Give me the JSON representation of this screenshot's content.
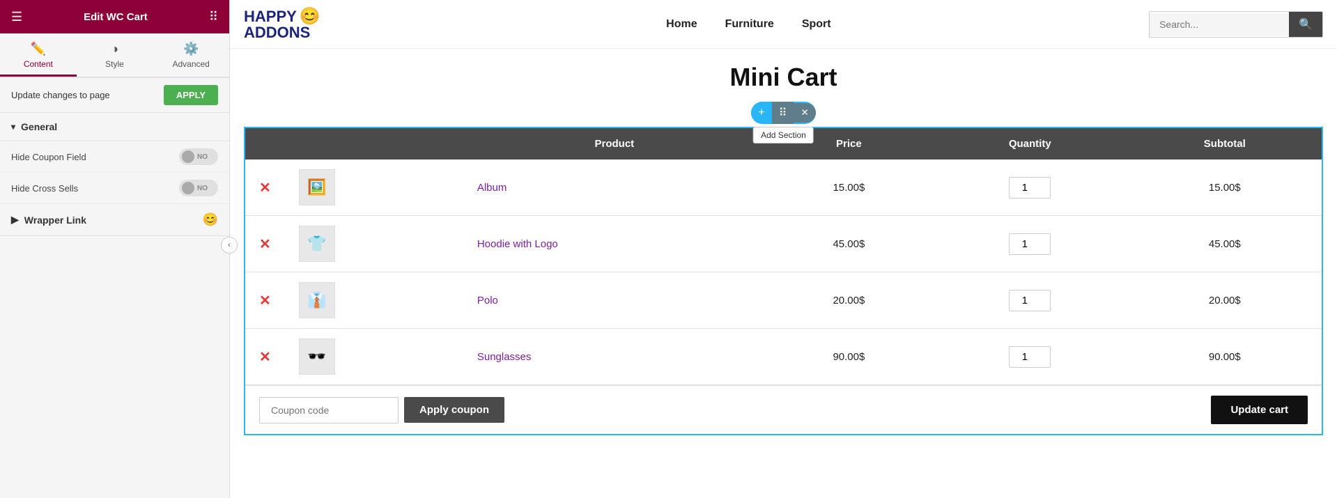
{
  "header": {
    "title": "Edit WC Cart"
  },
  "tabs": [
    {
      "id": "content",
      "label": "Content",
      "icon": "✏️",
      "active": true
    },
    {
      "id": "style",
      "label": "Style",
      "icon": "◑",
      "active": false
    },
    {
      "id": "advanced",
      "label": "Advanced",
      "icon": "⚙️",
      "active": false
    }
  ],
  "panel": {
    "update_label": "Update changes to page",
    "apply_btn": "APPLY",
    "general_section": "General",
    "hide_coupon_field_label": "Hide Coupon Field",
    "hide_cross_sells_label": "Hide Cross Sells",
    "wrapper_link_label": "Wrapper Link",
    "toggle_no": "NO"
  },
  "nav": {
    "logo_line1": "HAPPY",
    "logo_line2": "ADDONS",
    "logo_emoji": "😊",
    "links": [
      "Home",
      "Furniture",
      "Sport"
    ],
    "search_placeholder": "Search..."
  },
  "page": {
    "title": "Mini Cart",
    "add_section_tooltip": "Add Section"
  },
  "cart": {
    "headers": [
      "",
      "",
      "Product",
      "Price",
      "Quantity",
      "Subtotal"
    ],
    "items": [
      {
        "id": 1,
        "name": "Album",
        "thumb": "🖼️",
        "price": "15.00$",
        "qty": 1,
        "subtotal": "15.00$"
      },
      {
        "id": 2,
        "name": "Hoodie with Logo",
        "thumb": "👕",
        "price": "45.00$",
        "qty": 1,
        "subtotal": "45.00$"
      },
      {
        "id": 3,
        "name": "Polo",
        "thumb": "👔",
        "price": "20.00$",
        "qty": 1,
        "subtotal": "20.00$"
      },
      {
        "id": 4,
        "name": "Sunglasses",
        "thumb": "🕶️",
        "price": "90.00$",
        "qty": 1,
        "subtotal": "90.00$"
      }
    ],
    "coupon_placeholder": "Coupon code",
    "apply_coupon_btn": "Apply coupon",
    "update_cart_btn": "Update cart"
  },
  "colors": {
    "primary": "#8e0038",
    "accent": "#29b6f6",
    "dark": "#4a4a4a",
    "purple": "#7b1fa2",
    "green": "#4caf50"
  }
}
